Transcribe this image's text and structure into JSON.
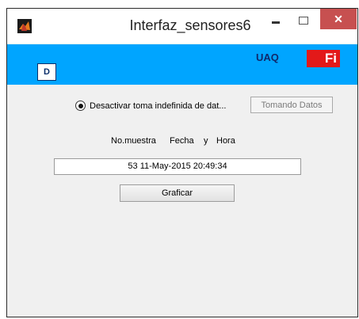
{
  "window": {
    "title": "Interfaz_sensores6",
    "close_glyph": "✕"
  },
  "banner": {
    "logo_left_text": "D",
    "uaq_text": "UAQ",
    "logo_right_text": "Fi",
    "color": "#00a5ff"
  },
  "controls": {
    "radio_label": "Desactivar toma indefinida de dat...",
    "tomando_button": "Tomando Datos",
    "headers": {
      "muestra": "No.muestra",
      "fecha": "Fecha",
      "y": "y",
      "hora": "Hora"
    },
    "data_value": "53 11-May-2015 20:49:34",
    "graficar_button": "Graficar"
  }
}
